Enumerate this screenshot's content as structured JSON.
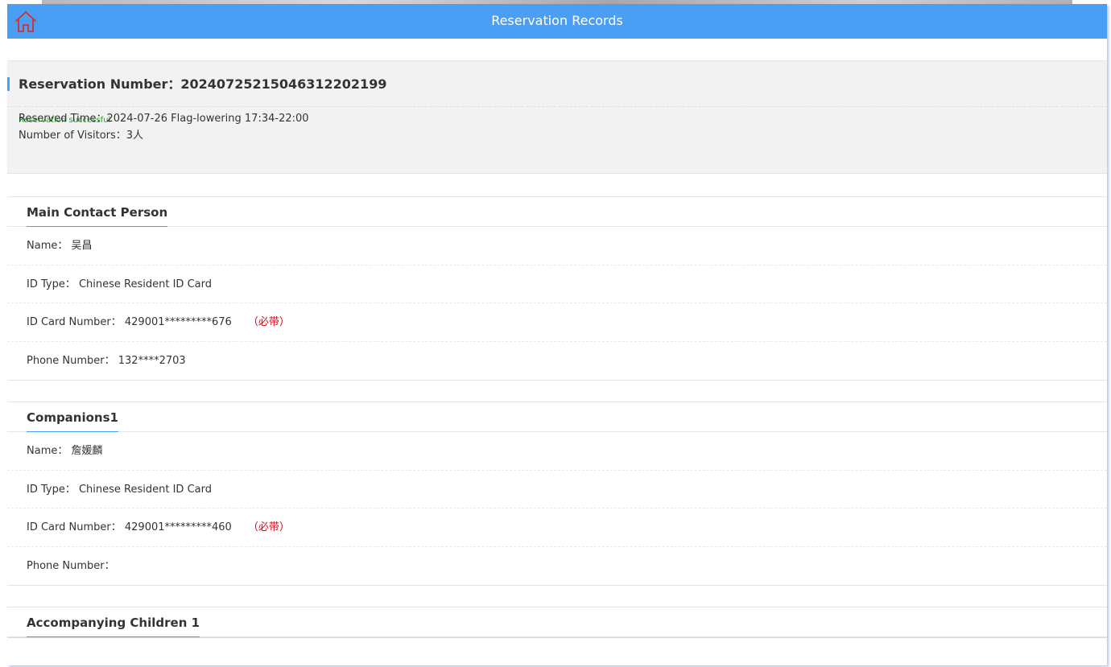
{
  "header": {
    "title": "Reservation Records",
    "home_icon": "home-icon",
    "color": "#4a9ef3",
    "home_icon_color": "#d0312d"
  },
  "summary": {
    "reservation_number": "Reservation Number：20240725215046312202199",
    "status": "Reservation successful",
    "status_color": "#1aad19",
    "reserved_time": "Reserved Time：2024-07-26 Flag-lowering 17:34-22:00",
    "visitors": "Number of Visitors：3人"
  },
  "main_contact": {
    "title": "Main Contact Person",
    "name": "Name： 吴昌",
    "id_type": "ID Type： Chinese Resident ID Card",
    "id_number": "ID Card Number： 429001*********676",
    "required_note": "（必带）",
    "phone": "Phone Number： 132****2703"
  },
  "companion1": {
    "title": "Companions1",
    "name": "Name： 詹媛麟",
    "id_type": "ID Type： Chinese Resident ID Card",
    "id_number": "ID Card Number： 429001*********460",
    "required_note": "（必带）",
    "phone": "Phone Number："
  },
  "children1": {
    "title": "Accompanying Children 1"
  }
}
